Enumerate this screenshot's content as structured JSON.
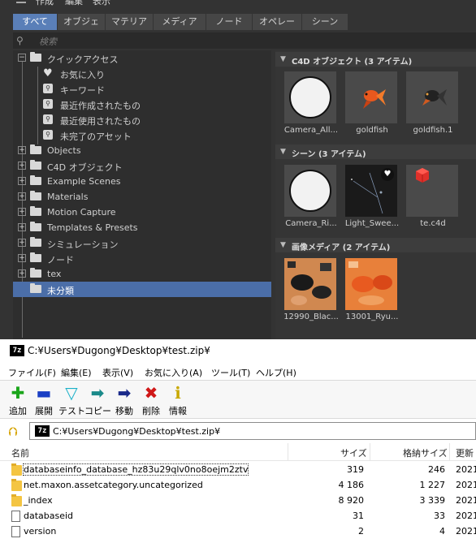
{
  "c4d": {
    "menubar": [
      "作成",
      "編集",
      "表示"
    ],
    "tabs": [
      "すべて",
      "オブジェクト",
      "マテリアル",
      "メディア",
      "ノード",
      "オペレータ",
      "シーン"
    ],
    "active_tab": "すべて",
    "search_placeholder": "検索",
    "tree": [
      {
        "label": "クイックアクセス",
        "icon": "folder-icon",
        "expander": "−"
      },
      {
        "label": "お気に入り",
        "icon": "heart-icon"
      },
      {
        "label": "キーワード",
        "icon": "search-folder-icon"
      },
      {
        "label": "最近作成されたもの",
        "icon": "search-folder-icon"
      },
      {
        "label": "最近使用されたもの",
        "icon": "search-folder-icon"
      },
      {
        "label": "未完了のアセット",
        "icon": "search-folder-icon"
      },
      {
        "label": "Objects",
        "icon": "folder-icon",
        "expander": "+"
      },
      {
        "label": "C4D オブジェクト",
        "icon": "folder-icon",
        "expander": "+"
      },
      {
        "label": "Example Scenes",
        "icon": "folder-icon",
        "expander": "+"
      },
      {
        "label": "Materials",
        "icon": "folder-icon",
        "expander": "+"
      },
      {
        "label": "Motion Capture",
        "icon": "folder-icon",
        "expander": "+"
      },
      {
        "label": "Templates & Presets",
        "icon": "folder-icon",
        "expander": "+"
      },
      {
        "label": "シミュレーション",
        "icon": "folder-icon",
        "expander": "+"
      },
      {
        "label": "ノード",
        "icon": "folder-icon",
        "expander": "+"
      },
      {
        "label": "tex",
        "icon": "folder-icon",
        "expander": "+"
      },
      {
        "label": "未分類",
        "icon": "folder-icon",
        "selected": true
      }
    ],
    "sections": [
      {
        "title": "C4D オブジェクト (3 アイテム)",
        "items": [
          "Camera_All...",
          "goldfish",
          "goldfish.1"
        ]
      },
      {
        "title": "シーン (3 アイテム)",
        "items": [
          "Camera_Ri...",
          "Light_Swee...",
          "te.c4d"
        ]
      },
      {
        "title": "画像メディア (2 アイテム)",
        "items": [
          "12990_Blac...",
          "13001_Ryu..."
        ]
      }
    ]
  },
  "zip": {
    "title": "C:¥Users¥Dugong¥Desktop¥test.zip¥",
    "menu": [
      "ファイル(F)",
      "編集(E)",
      "表示(V)",
      "お気に入り(A)",
      "ツール(T)",
      "ヘルプ(H)"
    ],
    "toolbar": [
      {
        "label": "追加",
        "icon": "plus-icon",
        "color": "#1aa51a",
        "glyph": "✚"
      },
      {
        "label": "展開",
        "icon": "minus-icon",
        "color": "#1a3fc4",
        "glyph": "▬"
      },
      {
        "label": "テスト",
        "icon": "check-icon",
        "color": "#1ab0c8",
        "glyph": "▽"
      },
      {
        "label": "コピー",
        "icon": "copy-arrow-icon",
        "color": "#1a8a8a",
        "glyph": "➡"
      },
      {
        "label": "移動",
        "icon": "move-arrow-icon",
        "color": "#1a2a8a",
        "glyph": "➡"
      },
      {
        "label": "削除",
        "icon": "delete-x-icon",
        "color": "#d01818",
        "glyph": "✖"
      },
      {
        "label": "情報",
        "icon": "info-icon",
        "color": "#c8a800",
        "glyph": "ℹ"
      }
    ],
    "address": "C:¥Users¥Dugong¥Desktop¥test.zip¥",
    "columns": [
      "名前",
      "サイズ",
      "格納サイズ",
      "更新"
    ],
    "rows": [
      {
        "name": "databaseinfo_database_hz83u29qlv0no8oejm2ztv",
        "size": "319",
        "packed": "246",
        "modified": "2021",
        "type": "folder"
      },
      {
        "name": "net.maxon.assetcategory.uncategorized",
        "size": "4 186",
        "packed": "1 227",
        "modified": "2021",
        "type": "folder"
      },
      {
        "name": "_index",
        "size": "8 920",
        "packed": "3 339",
        "modified": "2021",
        "type": "folder"
      },
      {
        "name": "databaseid",
        "size": "31",
        "packed": "33",
        "modified": "2021",
        "type": "file"
      },
      {
        "name": "version",
        "size": "2",
        "packed": "4",
        "modified": "2021",
        "type": "file"
      }
    ]
  }
}
